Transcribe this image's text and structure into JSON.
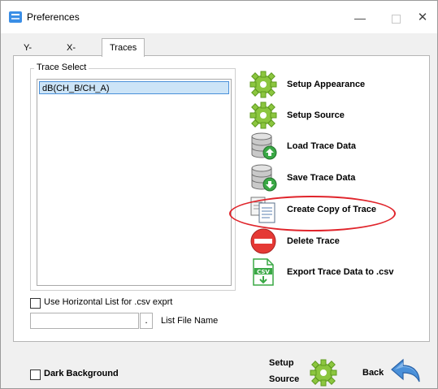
{
  "window": {
    "title": "Preferences",
    "minimize_glyph": "—",
    "close_glyph": "✕"
  },
  "tabs": [
    {
      "label": "Y-Axis"
    },
    {
      "label": "X-Axis"
    },
    {
      "label": "Traces",
      "selected": true
    }
  ],
  "trace_select": {
    "group_label": "Trace Select",
    "items": [
      "dB(CH_B/CH_A)"
    ]
  },
  "actions": [
    {
      "label": "Setup Appearance",
      "icon": "gear-icon"
    },
    {
      "label": "Setup Source",
      "icon": "gear-icon"
    },
    {
      "label": "Load Trace Data",
      "icon": "database-load-icon"
    },
    {
      "label": "Save Trace Data",
      "icon": "database-save-icon"
    },
    {
      "label": "Create Copy of Trace",
      "icon": "copy-documents-icon"
    },
    {
      "label": "Delete Trace",
      "icon": "delete-icon"
    },
    {
      "label": "Export Trace Data to .csv",
      "icon": "csv-export-icon"
    }
  ],
  "csv_options": {
    "horizontal_list_label": "Use Horizontal List for .csv exprt",
    "file_name_value": "",
    "browse_label": ".",
    "file_name_label": "List File Name"
  },
  "footer": {
    "dark_background_label": "Dark Background",
    "setup_source_line1": "Setup",
    "setup_source_line2": "Source",
    "back_label": "Back"
  },
  "colors": {
    "gear_green": "#8cc63f",
    "delete_red": "#e53935",
    "highlight_red": "#e0242b",
    "back_blue": "#4a90d9",
    "selection_blue": "#cce4f7"
  }
}
